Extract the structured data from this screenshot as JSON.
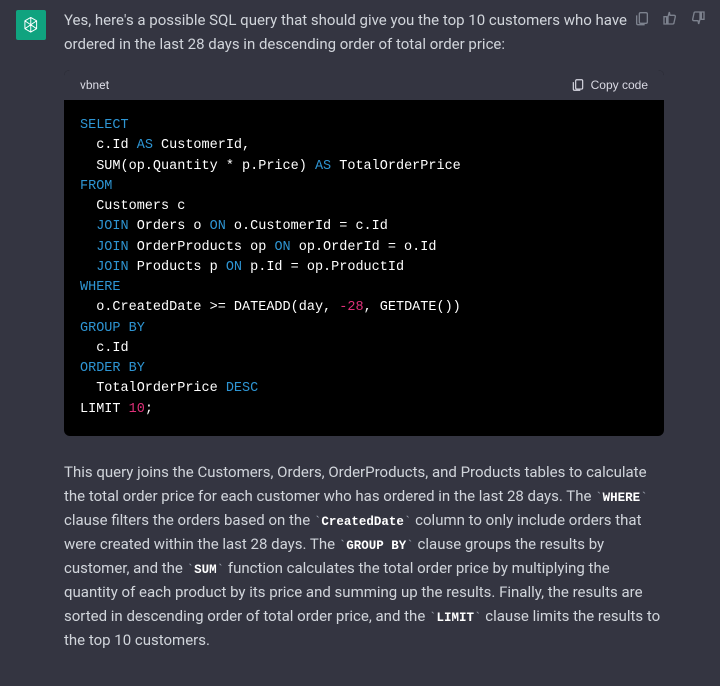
{
  "message": {
    "intro": "Yes, here's a possible SQL query that should give you the top 10 customers who have ordered in the last 28 days in descending order of total order price:",
    "explain_1": "This query joins the Customers, Orders, OrderProducts, and Products tables to calculate the total order price for each customer who has ordered in the last 28 days. The ",
    "code_where": "WHERE",
    "explain_2": " clause filters the orders based on the ",
    "code_created": "CreatedDate",
    "explain_3": " column to only include orders that were created within the last 28 days. The ",
    "code_groupby": "GROUP BY",
    "explain_4": " clause groups the results by customer, and the ",
    "code_sum": "SUM",
    "explain_5": " function calculates the total order price by multiplying the quantity of each product by its price and summing up the results. Finally, the results are sorted in descending order of total order price, and the ",
    "code_limit": "LIMIT",
    "explain_6": " clause limits the results to the top 10 customers."
  },
  "code": {
    "language": "vbnet",
    "copy_label": "Copy code",
    "sql": {
      "kw_select": "SELECT",
      "line_cid_1": "  c.Id ",
      "kw_as1": "AS",
      "line_cid_2": " CustomerId,",
      "line_sum_1": "  SUM(op.Quantity * p.Price) ",
      "kw_as2": "AS",
      "line_sum_2": " TotalOrderPrice",
      "kw_from": "FROM",
      "line_customers": "  Customers c",
      "kw_join1": "JOIN",
      "line_j1a": " Orders o ",
      "kw_on1": "ON",
      "line_j1b": " o.CustomerId = c.Id",
      "kw_join2": "JOIN",
      "line_j2a": " OrderProducts op ",
      "kw_on2": "ON",
      "line_j2b": " op.OrderId = o.Id",
      "kw_join3": "JOIN",
      "line_j3a": " Products p ",
      "kw_on3": "ON",
      "line_j3b": " p.Id = op.ProductId",
      "kw_where": "WHERE",
      "line_where_1": "  o.CreatedDate >= DATEADD(day, ",
      "num_neg28": "-28",
      "line_where_2": ", GETDATE())",
      "kw_group": "GROUP",
      "kw_by1": "BY",
      "line_group": "  c.Id",
      "kw_order": "ORDER",
      "kw_by2": "BY",
      "line_order_1": "  TotalOrderPrice ",
      "kw_desc": "DESC",
      "line_limit_1": "LIMIT ",
      "num_10": "10",
      "semi": ";"
    }
  }
}
